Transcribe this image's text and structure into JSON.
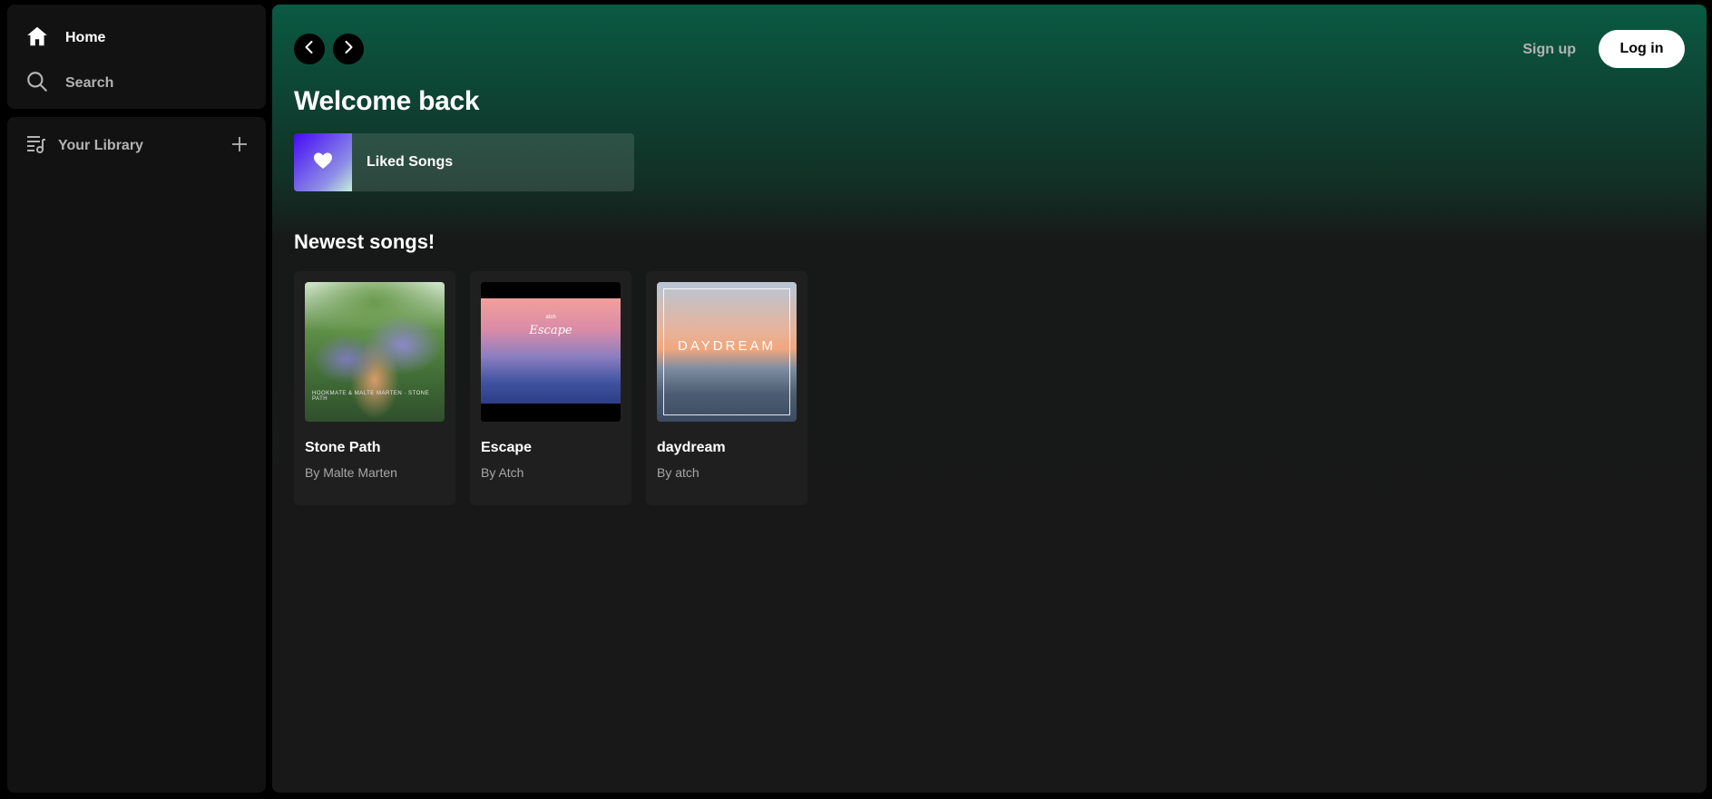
{
  "sidebar": {
    "home_label": "Home",
    "search_label": "Search",
    "library_label": "Your Library"
  },
  "header": {
    "signup_label": "Sign up",
    "login_label": "Log in"
  },
  "main": {
    "welcome_title": "Welcome back",
    "liked_songs_label": "Liked Songs",
    "section_title": "Newest songs!",
    "songs": [
      {
        "title": "Stone Path",
        "artist": "By Malte Marten",
        "art_text": "HOOKMATE & MALTE MARTEN · STONE PATH"
      },
      {
        "title": "Escape",
        "artist": "By Atch",
        "art_pre": "atch",
        "art_text": "Escape"
      },
      {
        "title": "daydream",
        "artist": "By atch",
        "art_text": "DAYDREAM"
      }
    ]
  },
  "colors": {
    "accent_green": "#0a5a42",
    "surface": "#121212",
    "card": "#1f1f1f",
    "muted_text": "#b3b3b3"
  }
}
